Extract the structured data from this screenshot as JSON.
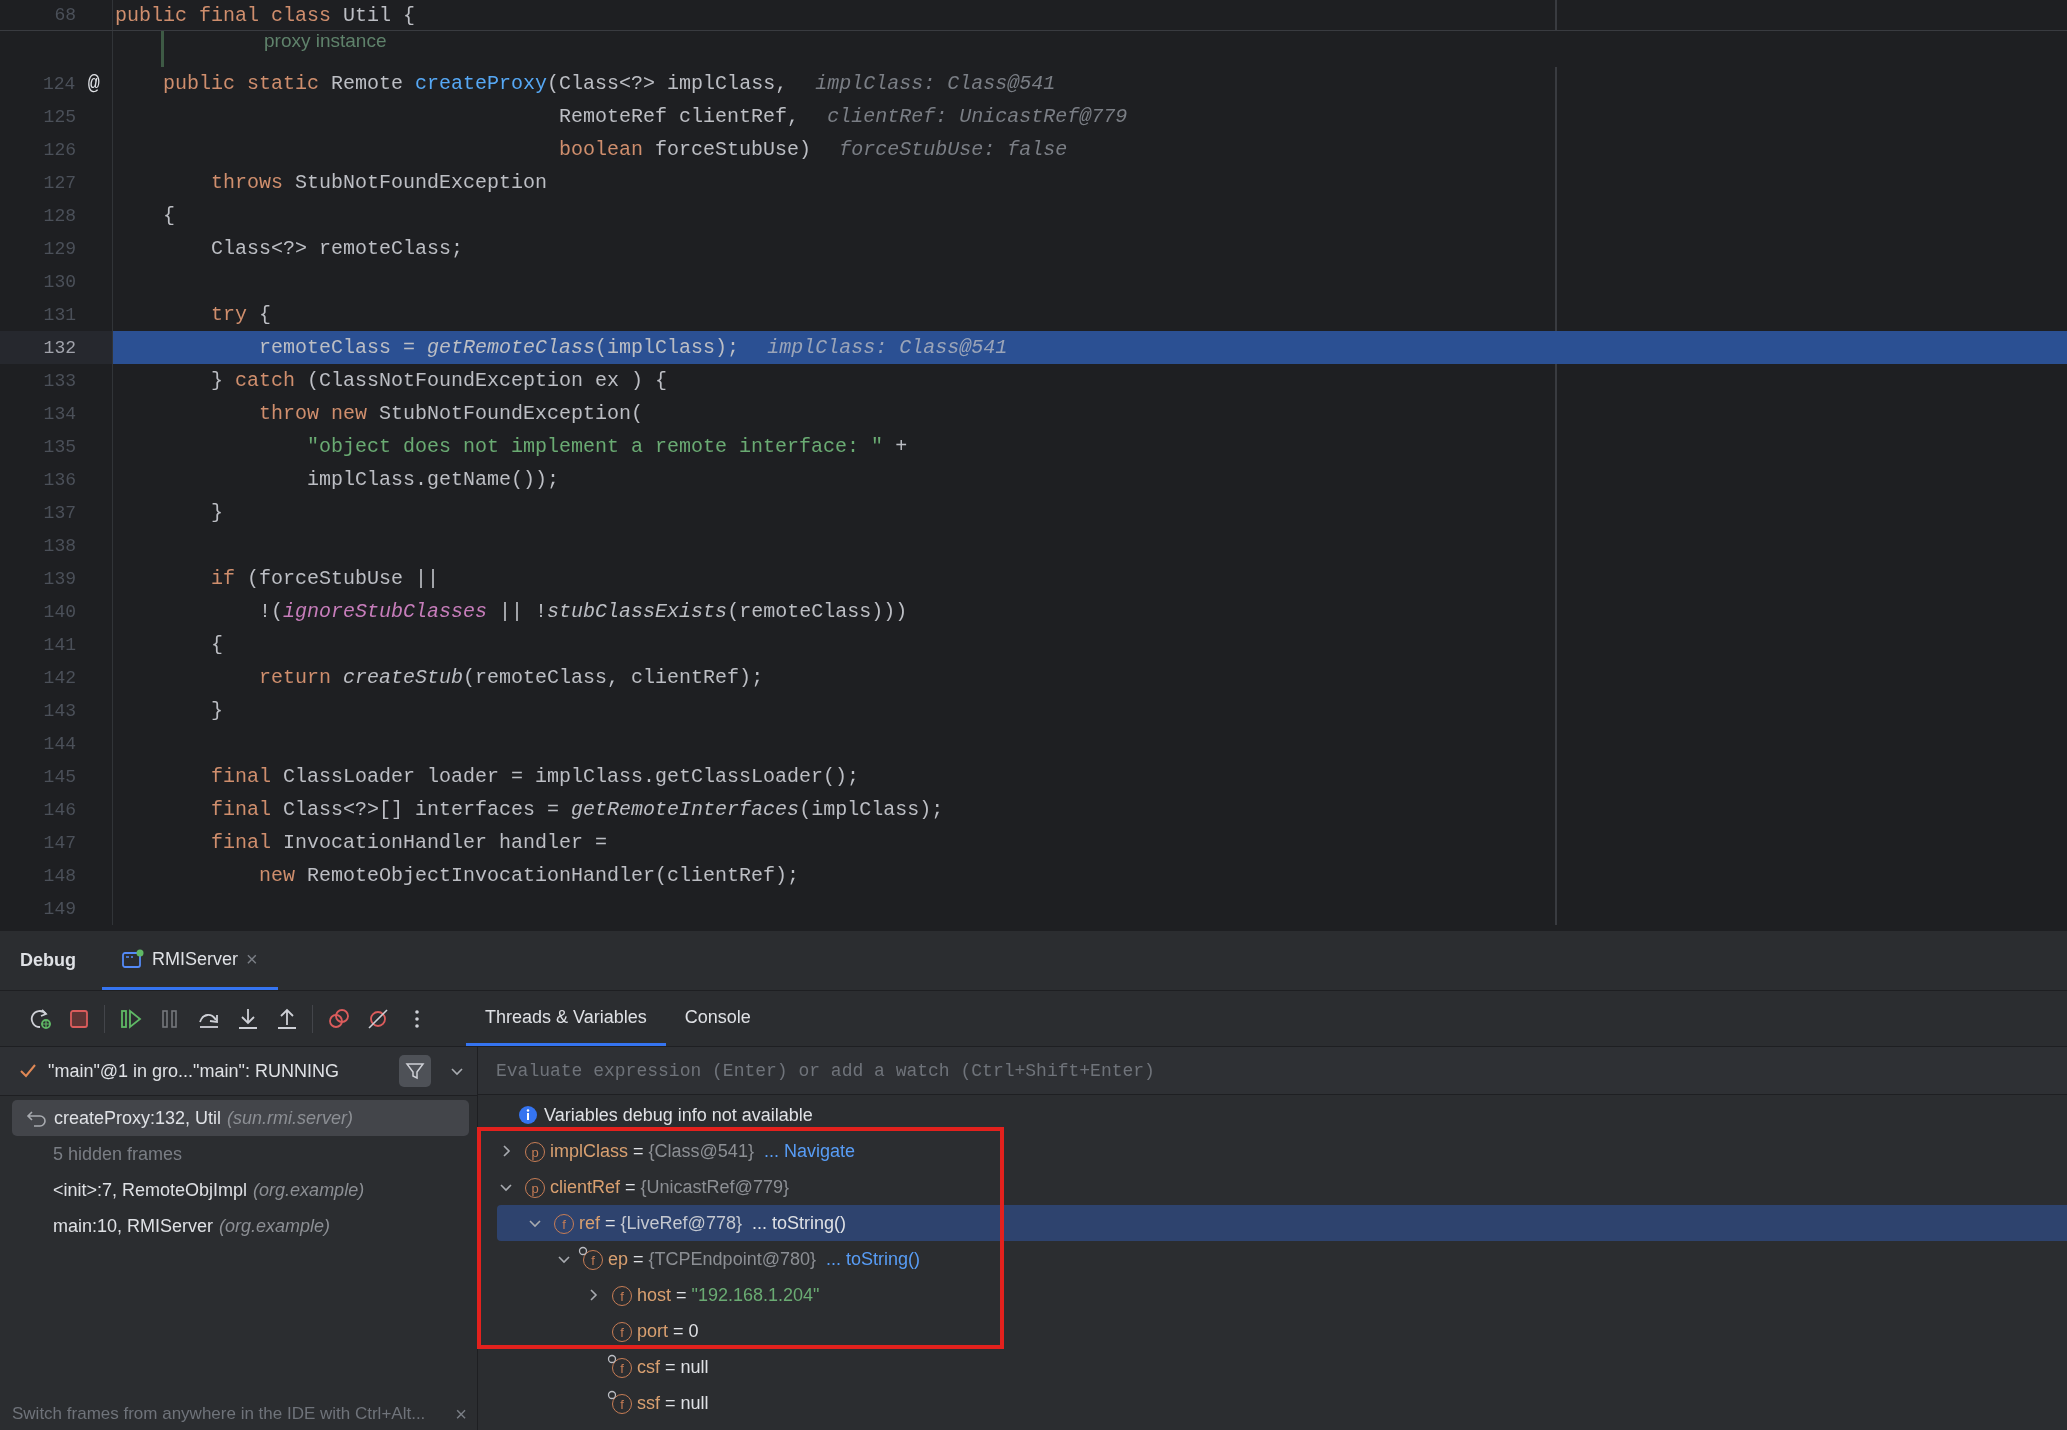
{
  "editor": {
    "sticky_line": {
      "number": "68",
      "tokens": [
        {
          "kind": "kw",
          "text": "public final class "
        },
        {
          "kind": "pl",
          "text": "Util {"
        }
      ]
    },
    "doc_fragment": "proxy instance",
    "lines": [
      {
        "number": "124",
        "gutter_mark": "@",
        "current": false,
        "tokens": [
          {
            "kind": "kw",
            "text": "    public static "
          },
          {
            "kind": "pl",
            "text": "Remote "
          },
          {
            "kind": "decl",
            "text": "createProxy"
          },
          {
            "kind": "pl",
            "text": "(Class<?> implClass,"
          }
        ],
        "hint": "implClass: Class@541"
      },
      {
        "number": "125",
        "current": false,
        "tokens": [
          {
            "kind": "pl",
            "text": "                                     RemoteRef clientRef,"
          }
        ],
        "hint": "clientRef: UnicastRef@779"
      },
      {
        "number": "126",
        "current": false,
        "tokens": [
          {
            "kind": "kw",
            "text": "                                     boolean "
          },
          {
            "kind": "pl",
            "text": "forceStubUse)"
          }
        ],
        "hint": "forceStubUse: false"
      },
      {
        "number": "127",
        "current": false,
        "tokens": [
          {
            "kind": "kw",
            "text": "        throws "
          },
          {
            "kind": "pl",
            "text": "StubNotFoundException"
          }
        ]
      },
      {
        "number": "128",
        "current": false,
        "tokens": [
          {
            "kind": "pl",
            "text": "    {"
          }
        ]
      },
      {
        "number": "129",
        "current": false,
        "tokens": [
          {
            "kind": "pl",
            "text": "        Class<?> remoteClass;"
          }
        ]
      },
      {
        "number": "130",
        "current": false
      },
      {
        "number": "131",
        "current": false,
        "tokens": [
          {
            "kind": "kw",
            "text": "        try "
          },
          {
            "kind": "pl",
            "text": "{"
          }
        ]
      },
      {
        "number": "132",
        "current": true,
        "tokens": [
          {
            "kind": "pl",
            "text": "            remoteClass = "
          },
          {
            "kind": "it",
            "text": "getRemoteClass"
          },
          {
            "kind": "pl",
            "text": "(implClass);"
          }
        ],
        "hint": "implClass: Class@541"
      },
      {
        "number": "133",
        "current": false,
        "tokens": [
          {
            "kind": "pl",
            "text": "        } "
          },
          {
            "kind": "kw",
            "text": "catch "
          },
          {
            "kind": "pl",
            "text": "(ClassNotFoundException ex ) {"
          }
        ]
      },
      {
        "number": "134",
        "current": false,
        "tokens": [
          {
            "kind": "kw",
            "text": "            throw new "
          },
          {
            "kind": "pl",
            "text": "StubNotFoundException("
          }
        ]
      },
      {
        "number": "135",
        "current": false,
        "tokens": [
          {
            "kind": "str",
            "text": "                \"object does not implement a remote interface: \""
          },
          {
            "kind": "pl",
            "text": " +"
          }
        ]
      },
      {
        "number": "136",
        "current": false,
        "tokens": [
          {
            "kind": "pl",
            "text": "                implClass.getName());"
          }
        ]
      },
      {
        "number": "137",
        "current": false,
        "tokens": [
          {
            "kind": "pl",
            "text": "        }"
          }
        ]
      },
      {
        "number": "138",
        "current": false
      },
      {
        "number": "139",
        "current": false,
        "tokens": [
          {
            "kind": "kw",
            "text": "        if "
          },
          {
            "kind": "pl",
            "text": "(forceStubUse ||"
          }
        ]
      },
      {
        "number": "140",
        "current": false,
        "tokens": [
          {
            "kind": "pl",
            "text": "            !("
          },
          {
            "kind": "fld",
            "text": "ignoreStubClasses"
          },
          {
            "kind": "pl",
            "text": " || !"
          },
          {
            "kind": "it",
            "text": "stubClassExists"
          },
          {
            "kind": "pl",
            "text": "(remoteClass)))"
          }
        ]
      },
      {
        "number": "141",
        "current": false,
        "tokens": [
          {
            "kind": "pl",
            "text": "        {"
          }
        ]
      },
      {
        "number": "142",
        "current": false,
        "tokens": [
          {
            "kind": "kw",
            "text": "            return "
          },
          {
            "kind": "it",
            "text": "createStub"
          },
          {
            "kind": "pl",
            "text": "(remoteClass, clientRef);"
          }
        ]
      },
      {
        "number": "143",
        "current": false,
        "tokens": [
          {
            "kind": "pl",
            "text": "        }"
          }
        ]
      },
      {
        "number": "144",
        "current": false
      },
      {
        "number": "145",
        "current": false,
        "tokens": [
          {
            "kind": "kw",
            "text": "        final "
          },
          {
            "kind": "pl",
            "text": "ClassLoader loader = implClass.getClassLoader();"
          }
        ]
      },
      {
        "number": "146",
        "current": false,
        "tokens": [
          {
            "kind": "kw",
            "text": "        final "
          },
          {
            "kind": "pl",
            "text": "Class<?>[] interfaces = "
          },
          {
            "kind": "it",
            "text": "getRemoteInterfaces"
          },
          {
            "kind": "pl",
            "text": "(implClass);"
          }
        ]
      },
      {
        "number": "147",
        "current": false,
        "tokens": [
          {
            "kind": "kw",
            "text": "        final "
          },
          {
            "kind": "pl",
            "text": "InvocationHandler handler ="
          }
        ]
      },
      {
        "number": "148",
        "current": false,
        "tokens": [
          {
            "kind": "kw",
            "text": "            new "
          },
          {
            "kind": "pl",
            "text": "RemoteObjectInvocationHandler(clientRef);"
          }
        ]
      },
      {
        "number": "149",
        "current": false
      }
    ]
  },
  "debug": {
    "title": "Debug",
    "tabs": [
      {
        "label": "RMIServer",
        "close": "×",
        "selected": true
      }
    ],
    "toolbar_groups": [
      [
        {
          "kind": "rerun",
          "disabled": false
        },
        {
          "kind": "stop",
          "disabled": false
        }
      ],
      [
        {
          "kind": "resume",
          "disabled": false
        },
        {
          "kind": "pause",
          "disabled": true
        },
        {
          "kind": "step-over",
          "disabled": false
        },
        {
          "kind": "step-into",
          "disabled": false
        },
        {
          "kind": "step-out",
          "disabled": false
        }
      ],
      [
        {
          "kind": "mute-breakpoints",
          "disabled": false
        },
        {
          "kind": "clear-breakpoints",
          "disabled": false
        },
        {
          "kind": "more",
          "disabled": false
        }
      ]
    ],
    "view_tabs": [
      {
        "label": "Threads & Variables",
        "selected": true
      },
      {
        "label": "Console",
        "selected": false
      }
    ],
    "thread": {
      "label": "\"main\"@1 in gro...\"main\": RUNNING",
      "filter_active": true
    },
    "frames": [
      {
        "kind": "frame",
        "method": "createProxy:132, Util",
        "package": "(sun.rmi.server)",
        "selected": true
      },
      {
        "kind": "hidden",
        "method": "5 hidden frames",
        "selected": false
      },
      {
        "kind": "frame",
        "method": "<init>:7, RemoteObjImpl",
        "package": "(org.example)",
        "selected": false
      },
      {
        "kind": "frame",
        "method": "main:10, RMIServer",
        "package": "(org.example)",
        "selected": false
      }
    ],
    "frames_hint": {
      "text": "Switch frames from anywhere in the IDE with Ctrl+Alt...",
      "close": "×"
    },
    "evaluate": {
      "placeholder": "Evaluate expression (Enter) or add a watch (Ctrl+Shift+Enter)"
    },
    "info": "Variables debug info not available",
    "variables": [
      {
        "icon": "p",
        "overlay": false,
        "name": "implClass",
        "operator": "=",
        "value": "{Class@541}",
        "kind": "object",
        "link": "... Navigate",
        "expanded": false,
        "selected": false
      },
      {
        "icon": "p",
        "overlay": false,
        "name": "clientRef",
        "operator": "=",
        "value": "{UnicastRef@779}",
        "kind": "object",
        "expanded": true,
        "selected": false,
        "children": [
          {
            "icon": "f",
            "overlay": false,
            "name": "ref",
            "operator": "=",
            "value": "{LiveRef@778}",
            "kind": "object",
            "link": "... toString()",
            "expanded": true,
            "selected": true,
            "children": [
              {
                "icon": "f",
                "overlay": true,
                "name": "ep",
                "operator": "=",
                "value": "{TCPEndpoint@780}",
                "kind": "object",
                "link": "... toString()",
                "expanded": true,
                "selected": false,
                "children": [
                  {
                    "icon": "f",
                    "overlay": false,
                    "name": "host",
                    "operator": "=",
                    "value": "\"192.168.1.204\"",
                    "kind": "string",
                    "expanded": false,
                    "selected": false
                  },
                  {
                    "icon": "f",
                    "overlay": false,
                    "name": "port",
                    "operator": "=",
                    "value": "0",
                    "kind": "plain",
                    "selected": false
                  },
                  {
                    "icon": "f",
                    "overlay": true,
                    "name": "csf",
                    "operator": "=",
                    "value": "null",
                    "kind": "plain",
                    "selected": false
                  },
                  {
                    "icon": "f",
                    "overlay": true,
                    "name": "ssf",
                    "operator": "=",
                    "value": "null",
                    "kind": "plain",
                    "selected": false
                  }
                ]
              }
            ]
          }
        ]
      }
    ]
  }
}
